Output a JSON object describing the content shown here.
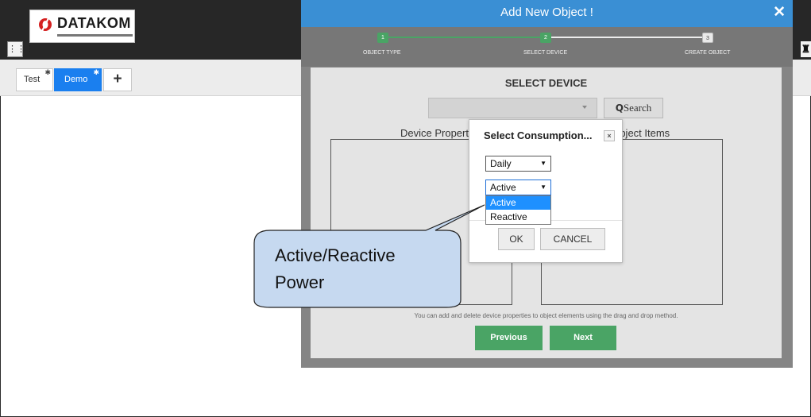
{
  "app": {
    "logo_text": "DATAKOM",
    "apps_icon": "apps-grid-icon",
    "right_icon": "user-icon"
  },
  "tabs": [
    {
      "label": "Test",
      "active": false
    },
    {
      "label": "Demo",
      "active": true
    }
  ],
  "tab_add_label": "+",
  "modal": {
    "title": "Add New Object !",
    "close_label": "✕",
    "steps": [
      {
        "number": "1",
        "label": "OBJECT TYPE",
        "done": true
      },
      {
        "number": "2",
        "label": "SELECT DEVICE",
        "done": true
      },
      {
        "number": "3",
        "label": "CREATE OBJECT",
        "done": false
      }
    ],
    "section_title": "SELECT DEVICE",
    "device_select_value": "",
    "search_label": "Search",
    "left_column_title": "Device Propert",
    "right_column_title": ")bject Items",
    "hint": "You can add and delete device properties to object elements using the drag and drop method.",
    "previous_label": "Previous",
    "next_label": "Next"
  },
  "dialog": {
    "title": "Select Consumption...",
    "close_label": "×",
    "period_value": "Daily",
    "type_value": "Active",
    "type_options": [
      "Active",
      "Reactive"
    ],
    "type_selected_index": 0,
    "ok_label": "OK",
    "cancel_label": "CANCEL"
  },
  "callout": {
    "line1": "Active/Reactive",
    "line2": "Power"
  },
  "colors": {
    "accent_blue": "#3a8fd4",
    "tab_active": "#1a7fef",
    "green": "#4aa465",
    "callout_fill": "#c6d9f0"
  }
}
